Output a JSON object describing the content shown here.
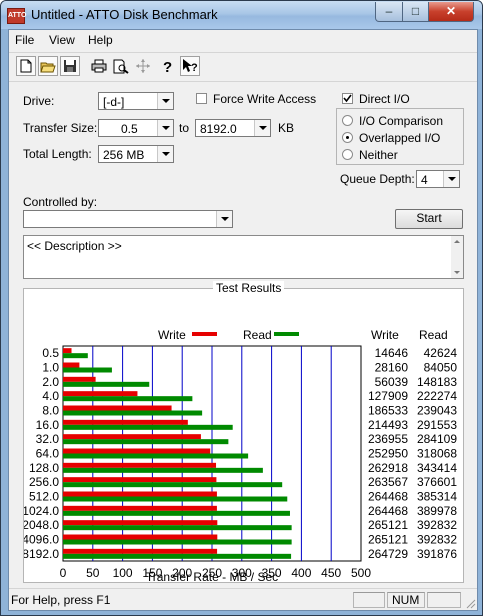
{
  "window": {
    "title": "Untitled - ATTO Disk Benchmark",
    "icon_text": "ATTO"
  },
  "menu": [
    "File",
    "View",
    "Help"
  ],
  "toolbar": {
    "icons": [
      "new-document-icon",
      "open-folder-icon",
      "save-icon",
      "print-icon",
      "print-preview-icon",
      "move-icon",
      "help-icon",
      "context-help-icon"
    ]
  },
  "settings": {
    "drive_label": "Drive:",
    "drive_value": "[-d-]",
    "force_write_label": "Force Write Access",
    "force_write_checked": false,
    "direct_io_label": "Direct I/O",
    "direct_io_checked": true,
    "transfer_size_label": "Transfer Size:",
    "transfer_from": "0.5",
    "to_label": "to",
    "transfer_to": "8192.0",
    "kb_label": "KB",
    "total_length_label": "Total Length:",
    "total_length_value": "256 MB",
    "io_modes": [
      {
        "label": "I/O Comparison",
        "selected": false
      },
      {
        "label": "Overlapped I/O",
        "selected": true
      },
      {
        "label": "Neither",
        "selected": false
      }
    ],
    "queue_depth_label": "Queue Depth:",
    "queue_depth_value": "4",
    "controlled_by_label": "Controlled by:",
    "controlled_by_value": "",
    "start_label": "Start",
    "description": "<< Description >>"
  },
  "results": {
    "title": "Test Results",
    "write_legend": "Write",
    "read_legend": "Read",
    "col_write": "Write",
    "col_read": "Read",
    "write_color": "#e60000",
    "read_color": "#008a00",
    "x_axis_label": "Transfer Rate - MB / Sec"
  },
  "chart_data": {
    "type": "bar",
    "orientation": "horizontal",
    "categories": [
      "0.5",
      "1.0",
      "2.0",
      "4.0",
      "8.0",
      "16.0",
      "32.0",
      "64.0",
      "128.0",
      "256.0",
      "512.0",
      "1024.0",
      "2048.0",
      "4096.0",
      "8192.0"
    ],
    "series": [
      {
        "name": "Write",
        "values": [
          14646,
          28160,
          56039,
          127909,
          186533,
          214493,
          236955,
          252950,
          262918,
          263567,
          264468,
          264468,
          265121,
          265121,
          264729
        ]
      },
      {
        "name": "Read",
        "values": [
          42624,
          84050,
          148183,
          222274,
          239043,
          291553,
          284109,
          318068,
          343414,
          376601,
          385314,
          389978,
          392832,
          392832,
          391876
        ]
      }
    ],
    "x_ticks": [
      "0",
      "50",
      "100",
      "150",
      "200",
      "250",
      "300",
      "350",
      "400",
      "450",
      "500"
    ],
    "xlim": [
      0,
      500
    ],
    "xlabel": "Transfer Rate - MB / Sec",
    "grid": true,
    "legend": "top"
  },
  "status": {
    "text": "For Help, press F1",
    "num": "NUM"
  }
}
